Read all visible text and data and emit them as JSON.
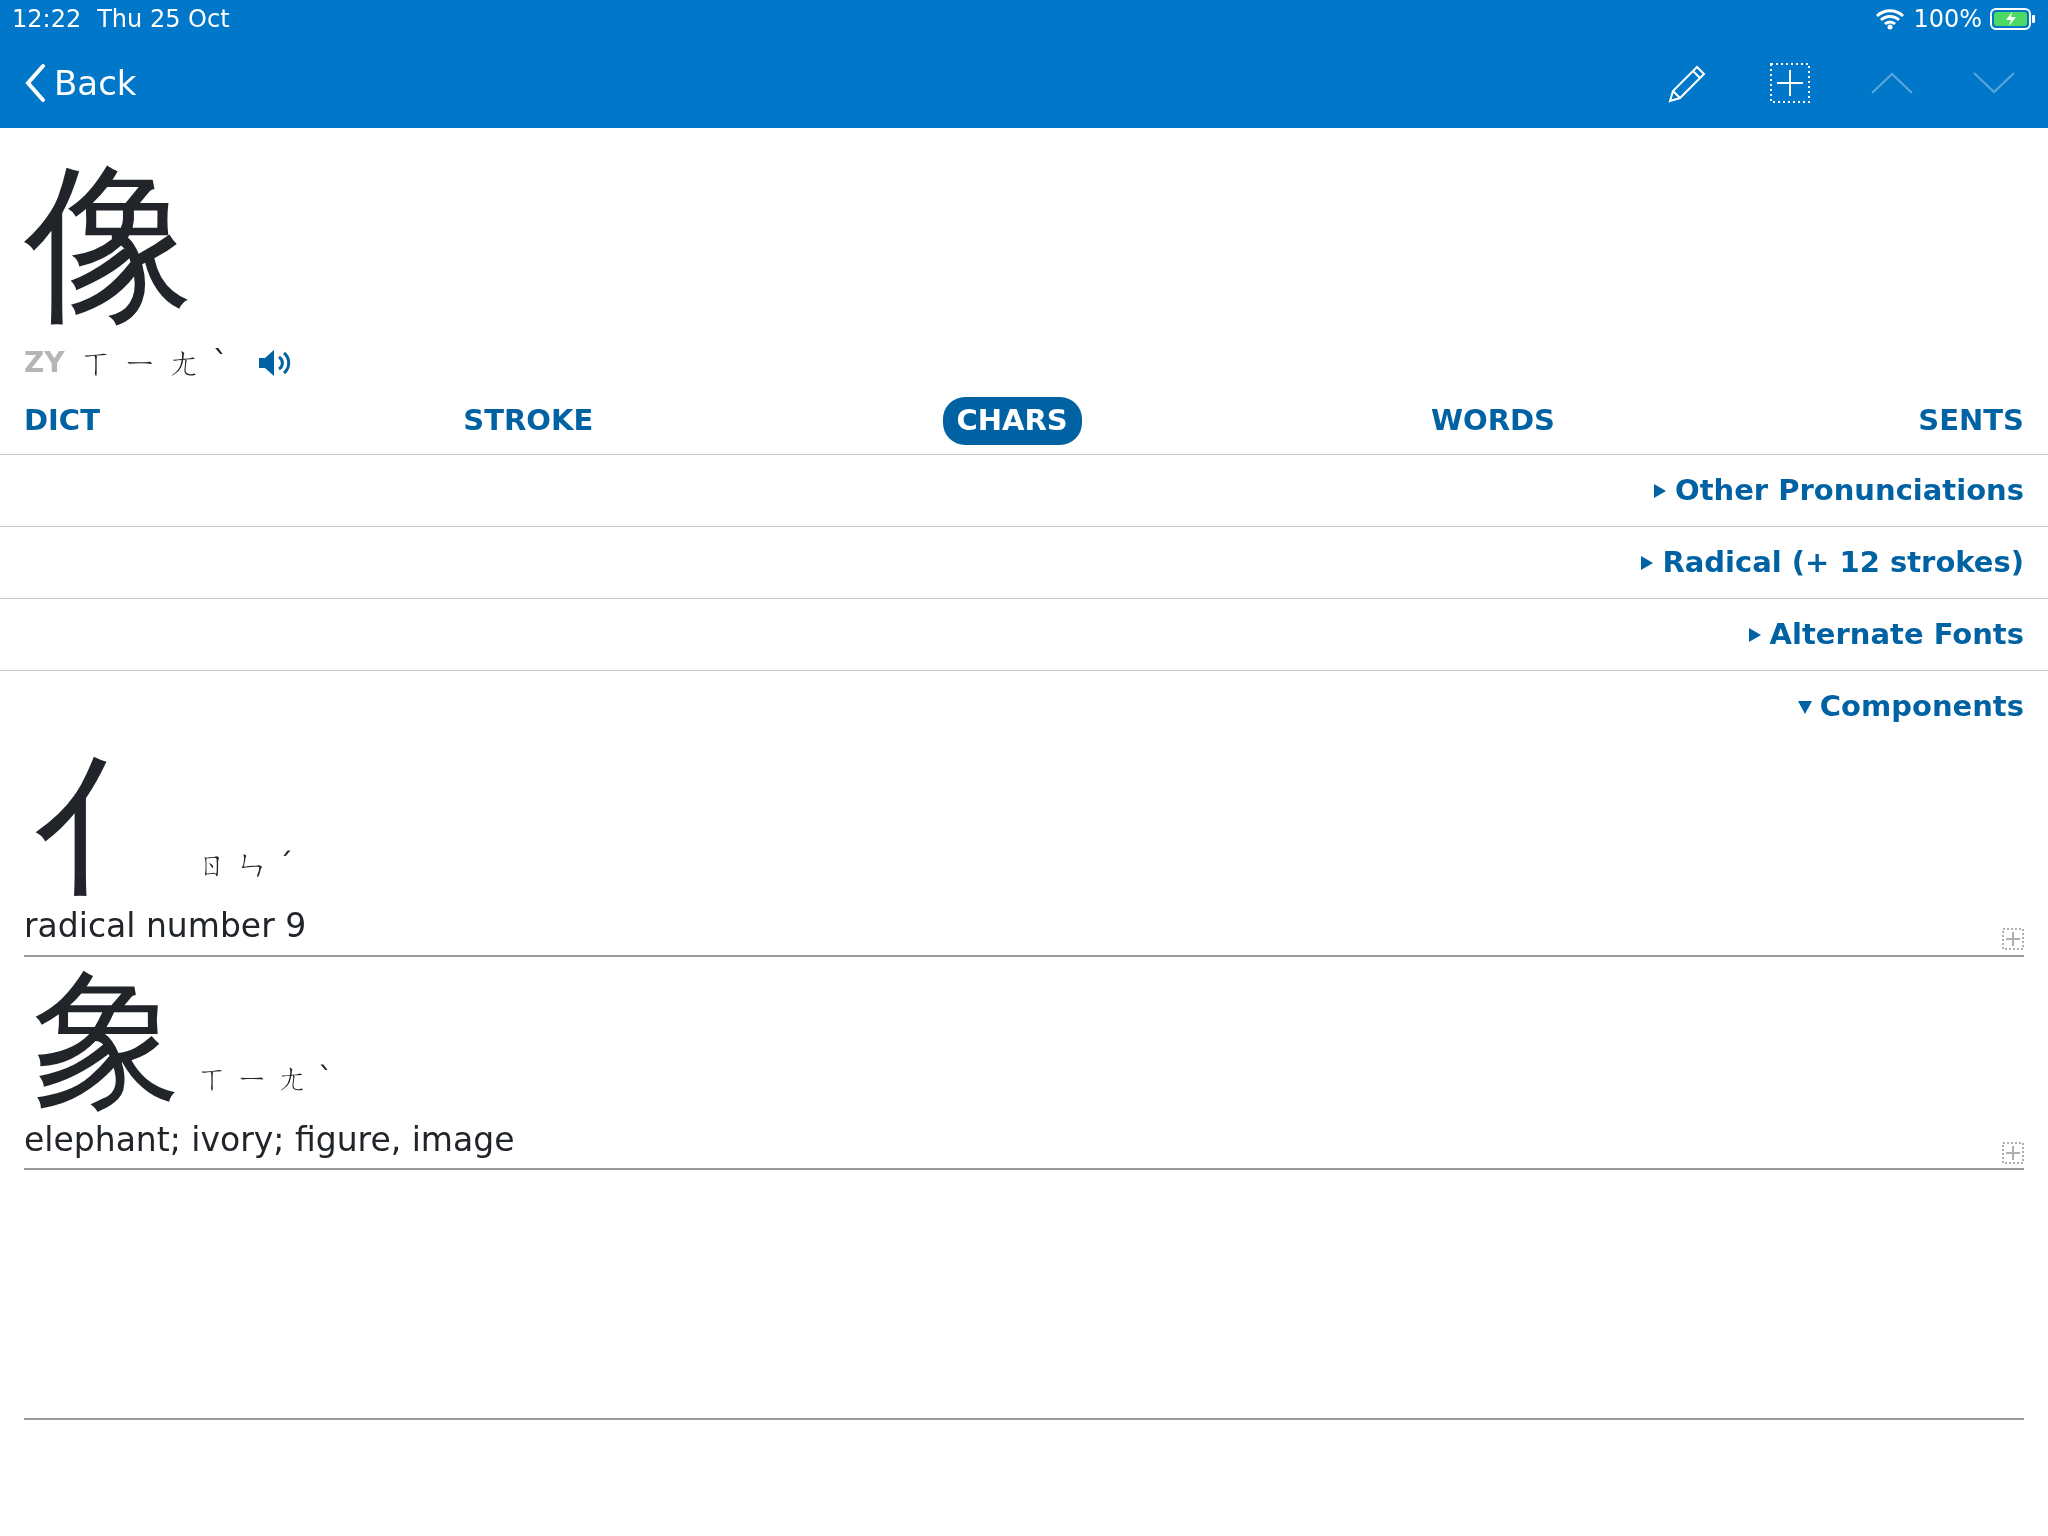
{
  "status_bar": {
    "time": "12:22",
    "date": "Thu 25 Oct",
    "battery": "100%"
  },
  "nav": {
    "back": "Back",
    "tools": [
      {
        "kind": "pencil",
        "disabled": false
      },
      {
        "kind": "add",
        "disabled": false
      },
      {
        "kind": "up",
        "disabled": true
      },
      {
        "kind": "down",
        "disabled": true
      }
    ]
  },
  "entry": {
    "character": "像",
    "system": "ZY",
    "reading": "ㄒㄧㄤˋ"
  },
  "tabs": [
    {
      "label": "DICT",
      "selected": false
    },
    {
      "label": "STROKE",
      "selected": false
    },
    {
      "label": "CHARS",
      "selected": true
    },
    {
      "label": "WORDS",
      "selected": false
    },
    {
      "label": "SENTS",
      "selected": false
    }
  ],
  "sections": [
    {
      "label": "Other Pronunciations",
      "expanded": false
    },
    {
      "label": "Radical (+ 12 strokes)",
      "expanded": false
    },
    {
      "label": "Alternate Fonts",
      "expanded": false
    },
    {
      "label": "Components",
      "expanded": true,
      "components": [
        {
          "character": "亻",
          "reading": "ㄖㄣˊ",
          "meaning": "radical number 9"
        },
        {
          "character": "象",
          "reading": "ㄒㄧㄤˋ",
          "meaning": "elephant; ivory; figure, image"
        }
      ]
    }
  ]
}
